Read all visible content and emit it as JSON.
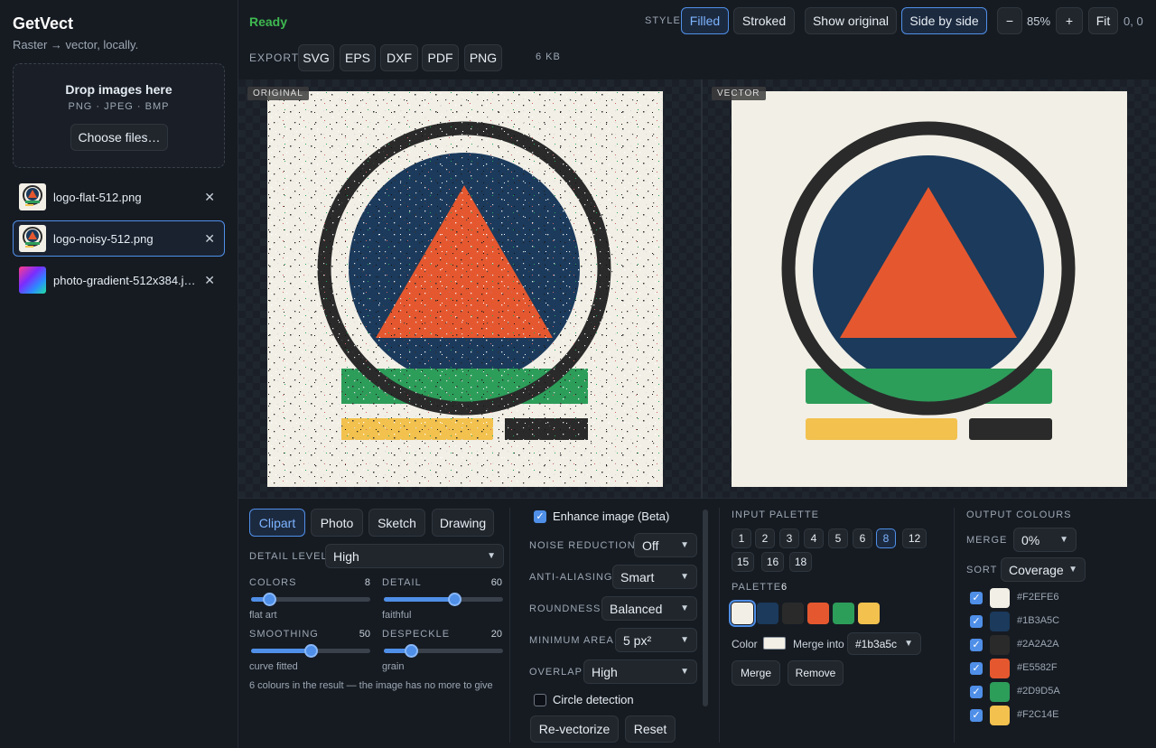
{
  "app": {
    "title": "GetVect",
    "subtitle": "Raster → vector, locally."
  },
  "dropzone": {
    "title": "Drop images here",
    "formats": "PNG · JPEG · BMP",
    "button": "Choose files…"
  },
  "files": [
    {
      "name": "logo-flat-512.png",
      "selected": false
    },
    {
      "name": "logo-noisy-512.png",
      "selected": true
    },
    {
      "name": "photo-gradient-512x384.j…",
      "selected": false
    }
  ],
  "header": {
    "status": "Ready",
    "style_label": "STYLE",
    "style_options": [
      "Filled",
      "Stroked"
    ],
    "style_active": "Filled",
    "show_original": "Show original",
    "side_by_side": "Side by side",
    "zoom_out": "−",
    "zoom": "85%",
    "zoom_in": "+",
    "fit": "Fit",
    "coords": "0, 0",
    "export_label": "EXPORT",
    "export_formats": [
      "SVG",
      "EPS",
      "DXF",
      "PDF",
      "PNG"
    ],
    "size": "6 KB"
  },
  "canvas": {
    "left_label": "ORIGINAL",
    "right_label": "VECTOR"
  },
  "presets": {
    "options": [
      "Clipart",
      "Photo",
      "Sketch",
      "Drawing"
    ],
    "active": "Clipart"
  },
  "detail_level": {
    "label": "DETAIL LEVEL",
    "value": "High"
  },
  "sliders": {
    "colors": {
      "label": "COLORS",
      "value": "8",
      "hint": "flat art",
      "fraction": 0.12
    },
    "detail": {
      "label": "DETAIL",
      "value": "60",
      "hint": "faithful",
      "fraction": 0.6
    },
    "smoothing": {
      "label": "SMOOTHING",
      "value": "50",
      "hint": "curve fitted",
      "fraction": 0.5
    },
    "despeckle": {
      "label": "DESPECKLE",
      "value": "20",
      "hint": "grain",
      "fraction": 0.2
    }
  },
  "result_note": "6 colours in the result — the image has no more to give",
  "enhance": {
    "label": "Enhance image (Beta)",
    "checked": true
  },
  "options": {
    "noise_reduction": {
      "label": "NOISE REDUCTION",
      "value": "Off"
    },
    "anti_aliasing": {
      "label": "ANTI-ALIASING",
      "value": "Smart"
    },
    "roundness": {
      "label": "ROUNDNESS",
      "value": "Balanced"
    },
    "minimum_area": {
      "label": "MINIMUM AREA",
      "value": "5 px²"
    },
    "overlap": {
      "label": "OVERLAP",
      "value": "High"
    }
  },
  "circle_detection": {
    "label": "Circle detection",
    "checked": false
  },
  "actions": {
    "revectorize": "Re-vectorize",
    "reset": "Reset"
  },
  "input_palette": {
    "label": "INPUT PALETTE",
    "counts": [
      "1",
      "2",
      "3",
      "4",
      "5",
      "6",
      "8",
      "12",
      "15",
      "16",
      "18"
    ],
    "active": "8",
    "palette_label": "PALETTE",
    "palette_count": "6",
    "swatches": [
      "#f2efe6",
      "#1b3a5c",
      "#2a2a2a",
      "#e5582f",
      "#2d9d5a",
      "#f2c14e"
    ],
    "color_label": "Color",
    "merge_into_label": "Merge into",
    "merge_into_value": "#1b3a5c",
    "merge": "Merge",
    "remove": "Remove"
  },
  "output_colours": {
    "label": "OUTPUT COLOURS",
    "merge_label": "MERGE",
    "merge_value": "0%",
    "sort_label": "SORT",
    "sort_value": "Coverage",
    "colors": [
      {
        "hex": "#F2EFE6",
        "checked": true
      },
      {
        "hex": "#1B3A5C",
        "checked": true
      },
      {
        "hex": "#2A2A2A",
        "checked": true
      },
      {
        "hex": "#E5582F",
        "checked": true
      },
      {
        "hex": "#2D9D5A",
        "checked": true
      },
      {
        "hex": "#F2C14E",
        "checked": true
      }
    ]
  }
}
